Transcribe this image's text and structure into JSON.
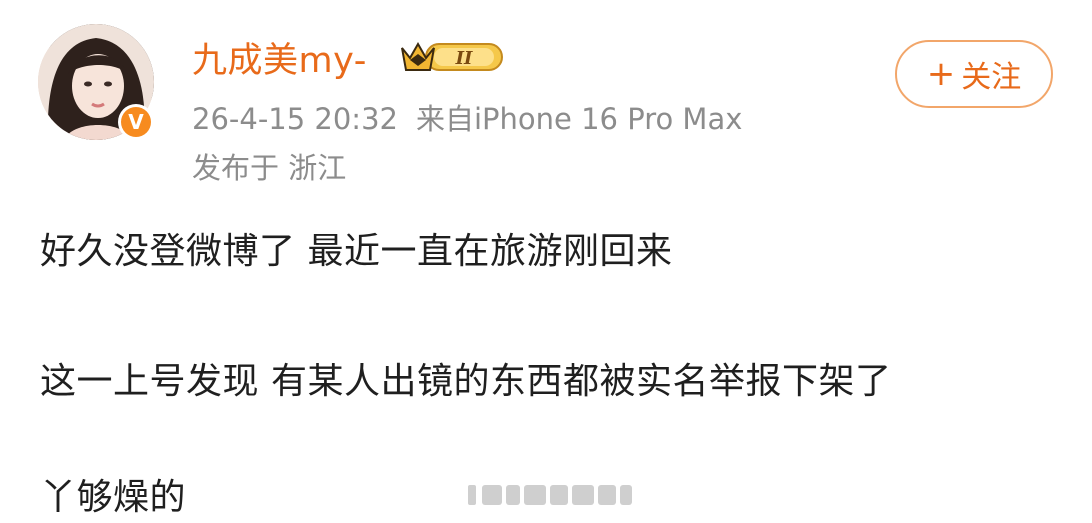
{
  "user": {
    "name": "九成美my-",
    "avatar_icon": "avatar-photo",
    "verified_badge": "V",
    "vip_level": "II",
    "accent_color": "#e86a1a"
  },
  "post_meta": {
    "time": "26-4-15 20:32",
    "source": "来自iPhone 16 Pro Max",
    "location": "发布于 浙江"
  },
  "follow_button": {
    "plus": "+",
    "label": "关注"
  },
  "post": {
    "lines": [
      "好久没登微博了 最近一直在旅游刚回来",
      "这一上号发现 有某人出镜的东西都被实名举报下架了",
      "丫够燥的"
    ]
  }
}
